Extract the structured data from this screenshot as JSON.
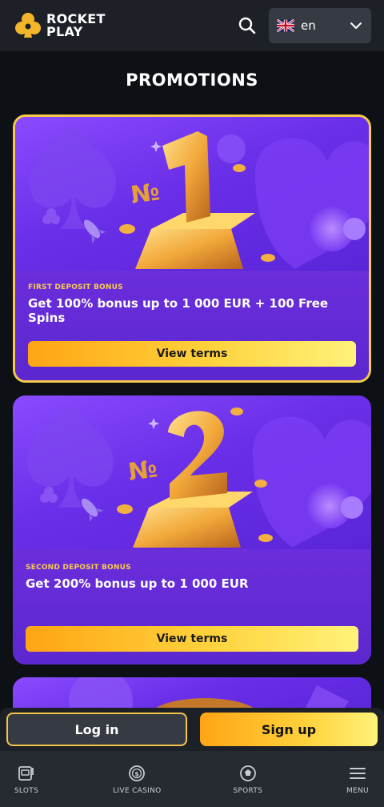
{
  "header": {
    "brand_line1": "ROCKET",
    "brand_line2": "PLAY",
    "brand_color": "#f3b52a",
    "language": {
      "code": "en",
      "flag": "uk-flag-icon"
    }
  },
  "page_title": "PROMOTIONS",
  "promotions": [
    {
      "tag": "FIRST DEPOSIT BONUS",
      "title": "Get 100% bonus up to 1 000 EUR + 100 Free Spins",
      "button": "View terms",
      "hero_number": "1",
      "hero_prefix": "№",
      "selected": true
    },
    {
      "tag": "SECOND DEPOSIT BONUS",
      "title": "Get 200% bonus up to 1 000 EUR",
      "button": "View terms",
      "hero_number": "2",
      "hero_prefix": "№",
      "selected": false
    }
  ],
  "auth": {
    "login": "Log in",
    "signup": "Sign up"
  },
  "nav": [
    {
      "label": "SLOTS",
      "icon": "slot-machine-icon"
    },
    {
      "label": "LIVE CASINO",
      "icon": "casino-chip-icon"
    },
    {
      "label": "SPORTS",
      "icon": "soccer-ball-icon"
    },
    {
      "label": "MENU",
      "icon": "hamburger-menu-icon"
    }
  ],
  "colors": {
    "accent": "#f5c94a",
    "card_purple": "#6d2fdf",
    "background": "#0d1116"
  }
}
